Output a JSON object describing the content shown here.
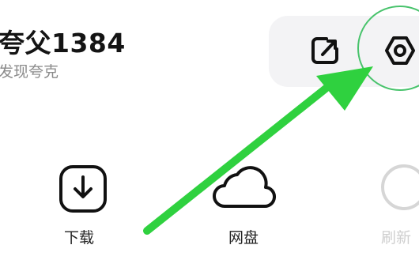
{
  "profile": {
    "name": "夸父1384",
    "subtitle": "发现夸克"
  },
  "top_actions": {
    "edit_icon": "edit-square-icon",
    "settings_icon": "hexagon-gear-icon"
  },
  "shortcuts": [
    {
      "label": "下载",
      "icon": "download-icon"
    },
    {
      "label": "网盘",
      "icon": "cloud-icon"
    },
    {
      "label": "刷新",
      "icon": "refresh-icon"
    }
  ],
  "annotation": {
    "arrow_color": "#2fd13f",
    "ring_color": "#48c36c",
    "target": "settings"
  }
}
